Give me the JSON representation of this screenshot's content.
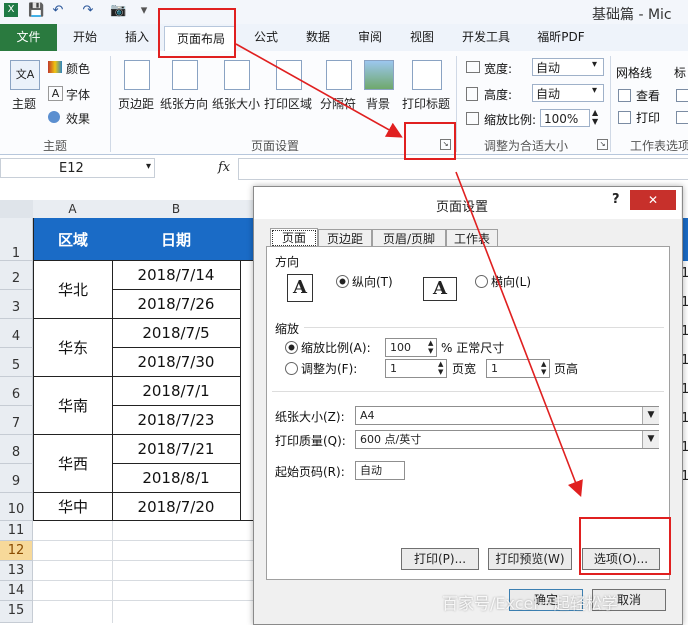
{
  "window": {
    "title": "基础篇 - Mic"
  },
  "ribbon_tabs": {
    "file": "文件",
    "items": [
      "开始",
      "插入",
      "页面布局",
      "公式",
      "数据",
      "审阅",
      "视图",
      "开发工具",
      "福昕PDF"
    ]
  },
  "ribbon": {
    "theme_group": {
      "themes": "主题",
      "colors": "颜色",
      "fonts": "字体",
      "effects": "效果",
      "label": "主题"
    },
    "page_setup": {
      "margins": "页边距",
      "orientation": "纸张方向",
      "size": "纸张大小",
      "print_area": "打印区域",
      "breaks": "分隔符",
      "background": "背景",
      "print_titles": "打印标题",
      "label": "页面设置"
    },
    "scale_to_fit": {
      "width_label": "宽度:",
      "width_value": "自动",
      "height_label": "高度:",
      "height_value": "自动",
      "scale_label": "缩放比例:",
      "scale_value": "100%",
      "label": "调整为合适大小"
    },
    "sheet_options": {
      "gridlines": "网格线",
      "view": "查看",
      "print": "打印",
      "headings": "标",
      "label": "工作表选项"
    }
  },
  "formula_bar": {
    "name_box": "E12",
    "fx": "fx"
  },
  "grid": {
    "columns": [
      "A",
      "B"
    ],
    "rows": [
      "1",
      "2",
      "3",
      "4",
      "5",
      "6",
      "7",
      "8",
      "9",
      "10",
      "11",
      "12",
      "13",
      "14",
      "15"
    ],
    "header": {
      "region": "区域",
      "date": "日期"
    },
    "regions": [
      "华北",
      "华东",
      "华南",
      "华西",
      "华中"
    ],
    "dates": [
      "2018/7/14",
      "2018/7/26",
      "2018/7/5",
      "2018/7/30",
      "2018/7/1",
      "2018/7/23",
      "2018/7/21",
      "2018/8/1",
      "2018/7/20"
    ],
    "edge_values": [
      "1",
      "1",
      "1",
      "1",
      "1",
      "1",
      "1",
      "1"
    ]
  },
  "dialog": {
    "title": "页面设置",
    "help": "?",
    "close": "✕",
    "tabs": [
      "页面",
      "页边距",
      "页眉/页脚",
      "工作表"
    ],
    "orientation": {
      "label": "方向",
      "portrait": "纵向(T)",
      "landscape": "横向(L)"
    },
    "scaling": {
      "label": "缩放",
      "adjust_to": "缩放比例(A):",
      "percent_value": "100",
      "percent_suffix": "% 正常尺寸",
      "fit_to": "调整为(F):",
      "pages_wide_value": "1",
      "pages_wide": "页宽",
      "pages_tall_value": "1",
      "pages_tall": "页高"
    },
    "paper_size": {
      "label": "纸张大小(Z):",
      "value": "A4"
    },
    "print_quality": {
      "label": "打印质量(Q):",
      "value": "600 点/英寸"
    },
    "first_page": {
      "label": "起始页码(R):",
      "value": "自动"
    },
    "buttons": {
      "print": "打印(P)...",
      "preview": "打印预览(W)",
      "options": "选项(O)...",
      "ok": "确定",
      "cancel": "取消"
    }
  },
  "watermark": "百家号/Excel一起轻松学",
  "colors": {
    "header_fill": "#1a6bc6",
    "annotation_red": "#e02020",
    "file_tab": "#2a7a3f"
  }
}
